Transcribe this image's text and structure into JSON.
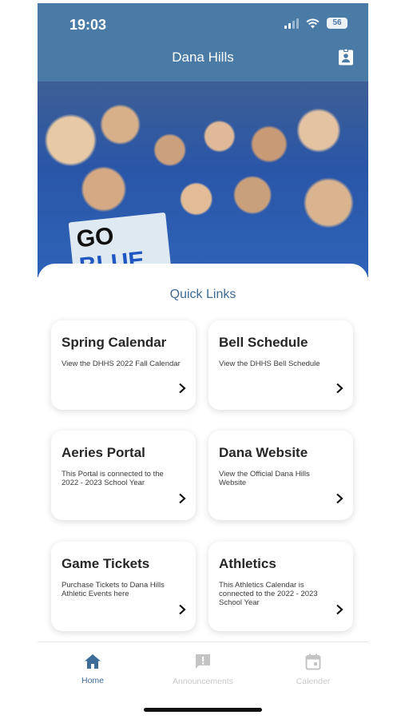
{
  "status": {
    "time": "19:03",
    "battery": "56"
  },
  "header": {
    "title": "Dana Hills"
  },
  "hero": {
    "sign_word1": "GO",
    "sign_word2": "BLUE"
  },
  "quick_links": {
    "heading": "Quick Links",
    "cards": [
      {
        "title": "Spring Calendar",
        "desc": "View the DHHS 2022 Fall Calendar"
      },
      {
        "title": "Bell Schedule",
        "desc": "View the DHHS Bell Schedule"
      },
      {
        "title": "Aeries Portal",
        "desc": "This Portal is connected to the 2022 - 2023 School Year"
      },
      {
        "title": "Dana Website",
        "desc": "View the Official Dana Hills Website"
      },
      {
        "title": "Game Tickets",
        "desc": "Purchase Tickets to Dana Hills Athletic Events here"
      },
      {
        "title": "Athletics",
        "desc": "This Athletics Calendar is connected to the 2022 - 2023 School Year"
      }
    ]
  },
  "tabs": [
    {
      "label": "Home",
      "icon": "home-icon",
      "active": true
    },
    {
      "label": "Announcements",
      "icon": "announcement-icon",
      "active": false
    },
    {
      "label": "Calender",
      "icon": "calendar-icon",
      "active": false
    }
  ],
  "colors": {
    "header": "#4a7aa6",
    "accent": "#3d6c98",
    "inactive": "#c8c8c8"
  }
}
